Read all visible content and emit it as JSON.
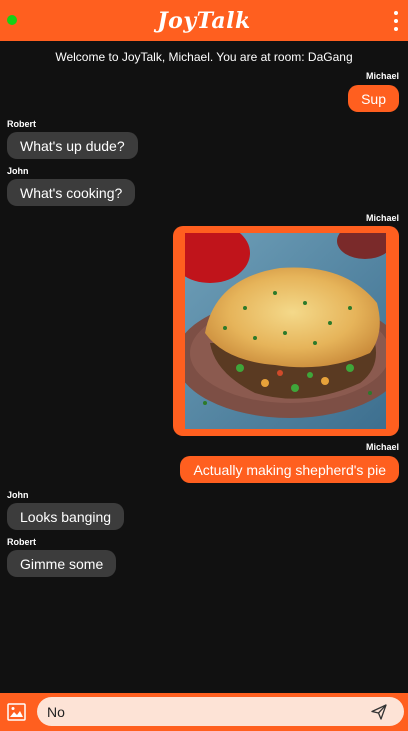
{
  "header": {
    "title": "JoyTalk",
    "status_color": "#16d116",
    "status_icon": "online-dot-icon",
    "menu_icon": "more-vertical-icon"
  },
  "welcome_text": "Welcome to JoyTalk, Michael. You are at room: DaGang",
  "messages": [
    {
      "sender": "Michael",
      "text": "Sup",
      "outgoing": true
    },
    {
      "sender": "Robert",
      "text": "What's up dude?",
      "outgoing": false
    },
    {
      "sender": "John",
      "text": "What's cooking?",
      "outgoing": false
    },
    {
      "sender": "Michael",
      "type": "image",
      "outgoing": true,
      "image_subject": "shepherd's pie"
    },
    {
      "sender": "Michael",
      "text": "Actually making shepherd's pie",
      "outgoing": true
    },
    {
      "sender": "John",
      "text": "Looks banging",
      "outgoing": false
    },
    {
      "sender": "Robert",
      "text": "Gimme some",
      "outgoing": false
    }
  ],
  "composer": {
    "value": "No",
    "gallery_icon": "image-icon",
    "send_icon": "send-icon"
  },
  "colors": {
    "accent": "#ff5f1f",
    "background": "#111111",
    "incoming_bubble": "#3c3c3c",
    "input_bg": "#fde3d6"
  }
}
